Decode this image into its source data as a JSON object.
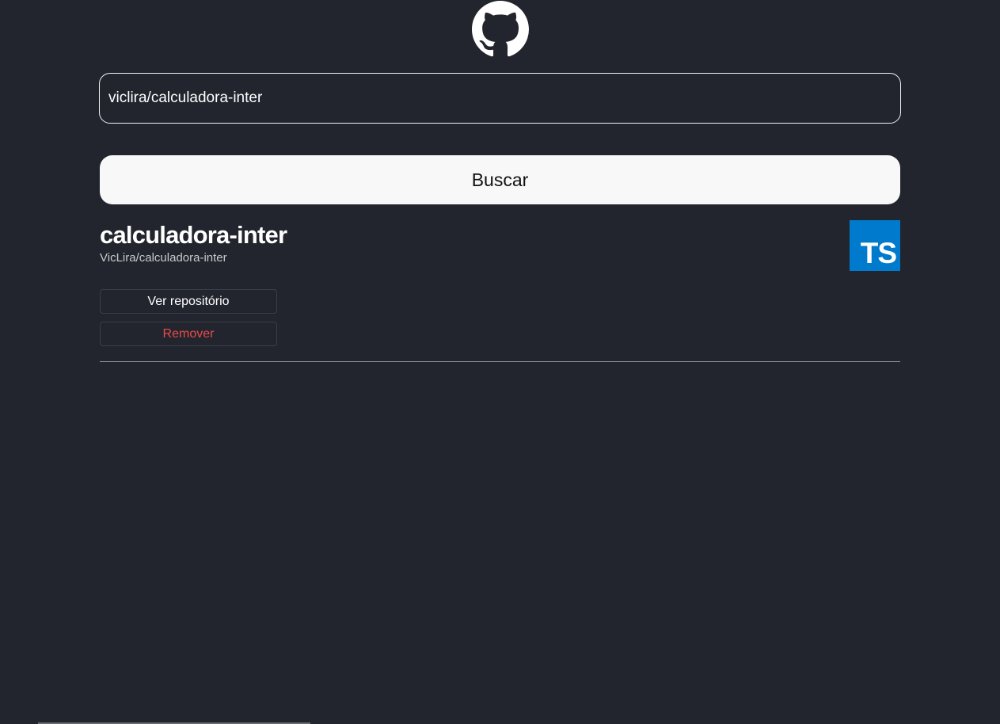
{
  "header": {
    "logo_icon": "github-octocat-icon"
  },
  "search": {
    "value": "viclira/calculadora-inter",
    "button_label": "Buscar"
  },
  "repositories": [
    {
      "name": "calculadora-inter",
      "full_name": "VicLira/calculadora-inter",
      "language_badge": "TS",
      "language_icon": "typescript-icon",
      "language_color": "#007acc",
      "view_label": "Ver repositório",
      "remove_label": "Remover",
      "remove_color": "#e84a4a"
    }
  ],
  "colors": {
    "background": "#22252d",
    "button_background": "#f8f8f8"
  }
}
